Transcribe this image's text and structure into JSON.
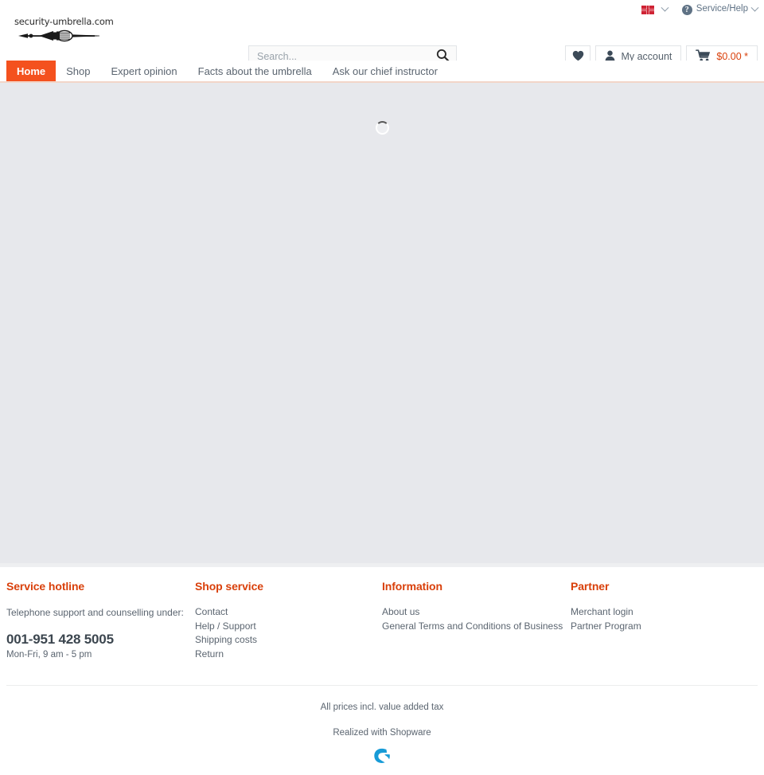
{
  "topbar": {
    "language": {
      "icon": "uk-flag-icon",
      "label": ""
    },
    "service": {
      "icon": "help-circle-icon",
      "label": "Service/Help"
    }
  },
  "header": {
    "logo": {
      "text": "security-umbrella.com",
      "icon": "umbrella-sword-logo-icon"
    },
    "search": {
      "placeholder": "Search...",
      "value": "",
      "icon": "search-icon"
    },
    "actions": {
      "wishlist": {
        "icon": "heart-icon",
        "label": ""
      },
      "account": {
        "icon": "user-icon",
        "label": "My account"
      },
      "cart": {
        "icon": "cart-icon",
        "amount": "$0.00 *"
      }
    }
  },
  "nav": {
    "items": [
      {
        "label": "Home",
        "active": true
      },
      {
        "label": "Shop",
        "active": false
      },
      {
        "label": "Expert opinion",
        "active": false
      },
      {
        "label": "Facts about the umbrella",
        "active": false
      },
      {
        "label": "Ask our chief instructor",
        "active": false
      }
    ]
  },
  "main": {
    "state": "loading",
    "spinner": "loading-spinner-icon"
  },
  "footer": {
    "columns": [
      {
        "heading": "Service hotline",
        "intro": "Telephone support and counselling under:",
        "phone": "001-951 428 5005",
        "hours": "Mon-Fri, 9 am - 5 pm",
        "links": []
      },
      {
        "heading": "Shop service",
        "links": [
          "Contact",
          "Help / Support",
          "Shipping costs",
          "Return"
        ]
      },
      {
        "heading": "Information",
        "links": [
          "About us",
          "General Terms and Conditions of Business"
        ]
      },
      {
        "heading": "Partner",
        "links": [
          "Merchant login",
          "Partner Program"
        ]
      }
    ],
    "bottom": {
      "tax_note": "All prices incl. value added tax",
      "realized": "Realized with Shopware",
      "logo_icon": "shopware-logo-icon"
    }
  },
  "colors": {
    "accent": "#d9400b",
    "nav_active": "#f4511e",
    "text": "#5b6570",
    "main_bg": "#e7e8ec",
    "shopware_blue": "#179bd7"
  }
}
